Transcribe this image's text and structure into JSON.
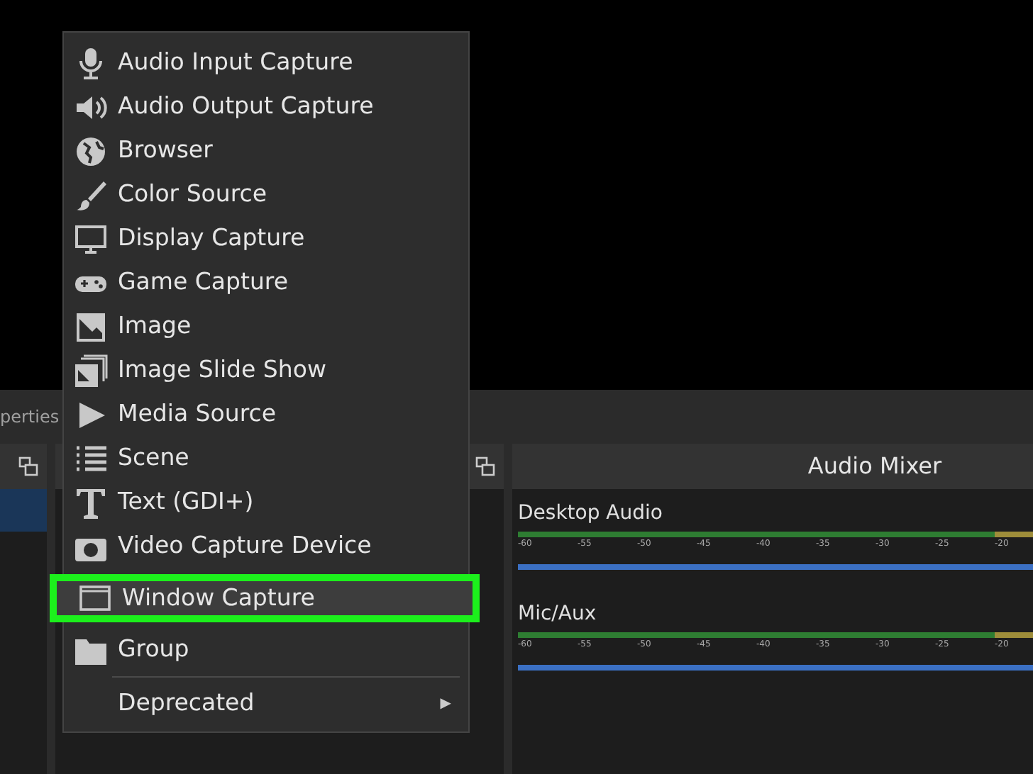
{
  "docks": {
    "properties_tab": "perties",
    "scenes": {
      "rows": [
        {
          "selected": true
        }
      ]
    },
    "audio_mixer": {
      "title": "Audio Mixer",
      "channels": [
        {
          "name": "Desktop Audio",
          "scale": [
            "-60",
            "-55",
            "-50",
            "-45",
            "-40",
            "-35",
            "-30",
            "-25",
            "-20"
          ],
          "level": 1
        },
        {
          "name": "Mic/Aux",
          "scale": [
            "-60",
            "-55",
            "-50",
            "-45",
            "-40",
            "-35",
            "-30",
            "-25",
            "-20"
          ],
          "level": 1
        }
      ]
    }
  },
  "menu": {
    "items": [
      {
        "kind": "mic",
        "label": "Audio Input Capture",
        "selected": false
      },
      {
        "kind": "speaker",
        "label": "Audio Output Capture",
        "selected": false
      },
      {
        "kind": "globe",
        "label": "Browser",
        "selected": false
      },
      {
        "kind": "brush",
        "label": "Color Source",
        "selected": false
      },
      {
        "kind": "monitor",
        "label": "Display Capture",
        "selected": false
      },
      {
        "kind": "gamepad",
        "label": "Game Capture",
        "selected": false
      },
      {
        "kind": "image",
        "label": "Image",
        "selected": false
      },
      {
        "kind": "slides",
        "label": "Image Slide Show",
        "selected": false
      },
      {
        "kind": "play",
        "label": "Media Source",
        "selected": false
      },
      {
        "kind": "list",
        "label": "Scene",
        "selected": false
      },
      {
        "kind": "text",
        "label": "Text (GDI+)",
        "selected": false
      },
      {
        "kind": "camera",
        "label": "Video Capture Device",
        "selected": false
      },
      {
        "kind": "window",
        "label": "Window Capture",
        "selected": true
      },
      {
        "kind": "folder",
        "label": "Group",
        "selected": false
      }
    ],
    "submenu": {
      "label": "Deprecated",
      "arrow": "▶"
    }
  }
}
